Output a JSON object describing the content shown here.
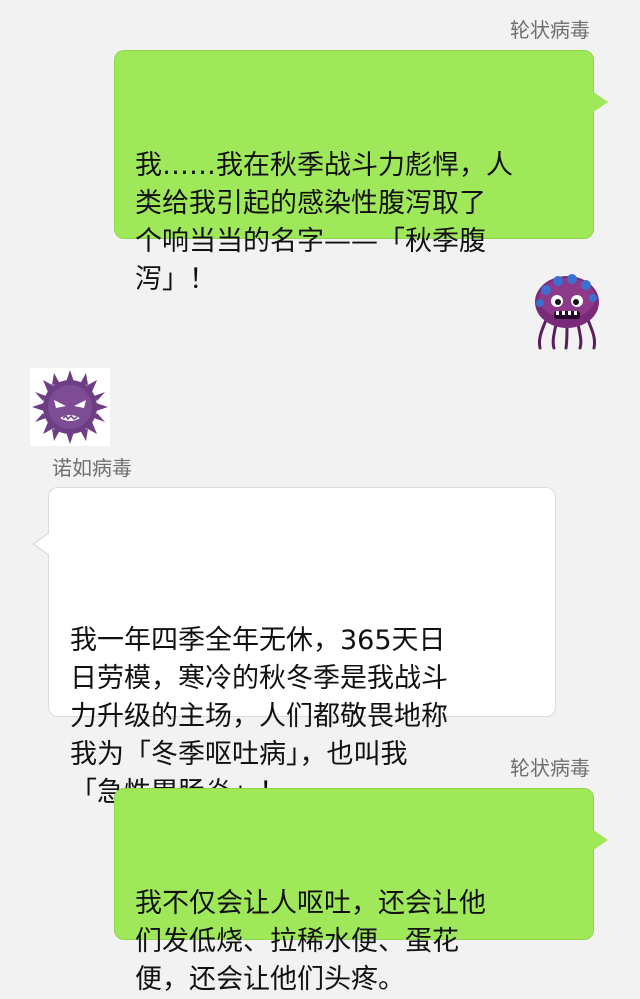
{
  "messages": [
    {
      "sender": "轮状病毒",
      "side": "right",
      "text": "我……我在秋季战斗力彪悍，人\n类给我引起的感染性腹泻取了\n个响当当的名字——「秋季腹\n泻」！"
    },
    {
      "sender": "诺如病毒",
      "side": "left",
      "text": "我一年四季全年无休，365天日\n日劳模，寒冷的秋冬季是我战斗\n力升级的主场，人们都敬畏地称\n我为「冬季呕吐病」，也叫我\n「急性胃肠炎」！"
    },
    {
      "sender": "轮状病毒",
      "side": "right",
      "text": "我不仅会让人呕吐，还会让他\n们发低烧、拉稀水便、蛋花\n便，还会让他们头疼。"
    }
  ],
  "avatars": {
    "rotavirus": {
      "icon": "rotavirus-avatar-icon",
      "color": "#7a2a78"
    },
    "norovirus": {
      "icon": "norovirus-avatar-icon",
      "color": "#6d3e84"
    }
  },
  "colors": {
    "background": "#f2f2f2",
    "outgoing_bubble": "#9fe85a",
    "incoming_bubble": "#ffffff",
    "sender_name": "#6f6f6f"
  }
}
